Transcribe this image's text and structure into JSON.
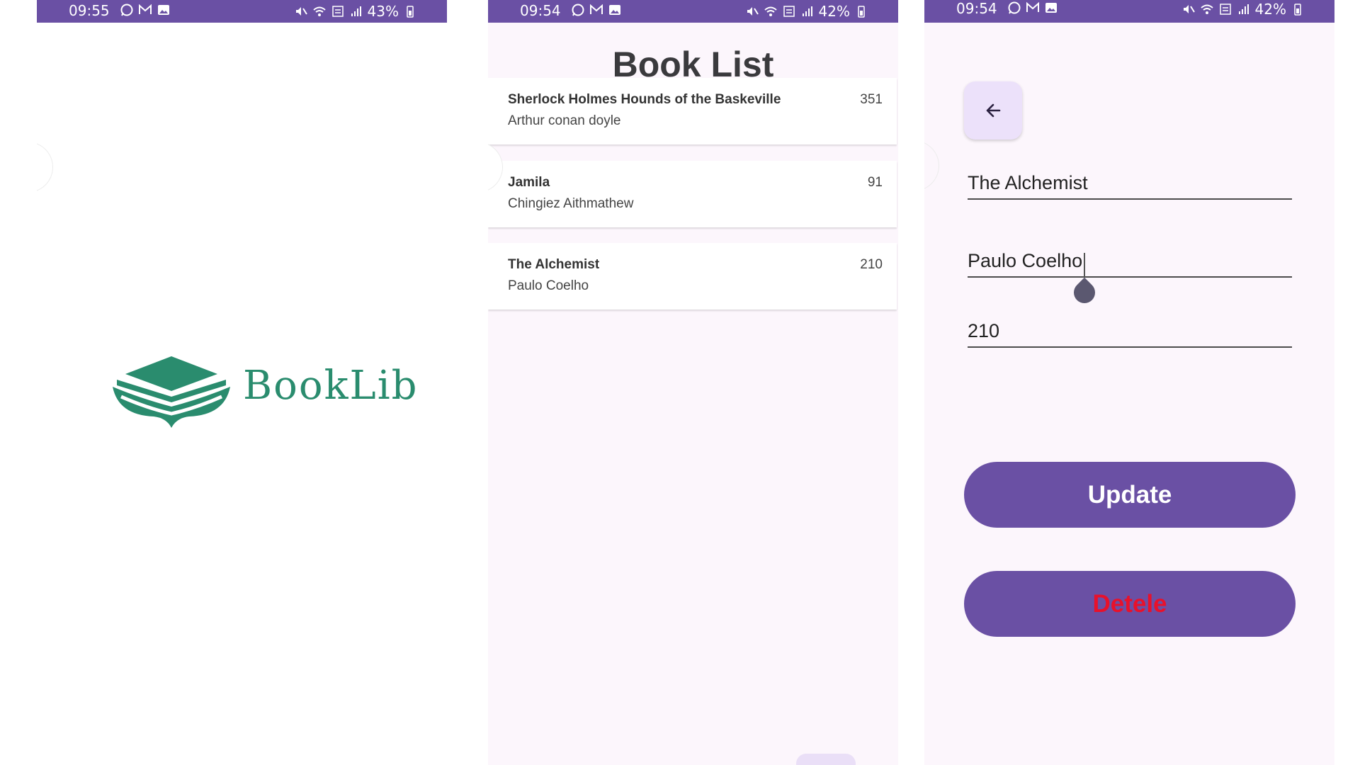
{
  "colors": {
    "status_bar": "#6a50a4",
    "accent": "#6a50a4",
    "brand_green": "#2a8c6e",
    "delete_text": "#e8112b",
    "screen_bg": "#fcf6fc"
  },
  "splash": {
    "status": {
      "time": "09:55",
      "battery": "43%"
    },
    "logo_text": "BookLib"
  },
  "list_screen": {
    "status": {
      "time": "09:54",
      "battery": "42%"
    },
    "title": "Book List",
    "books": [
      {
        "title": "Sherlock Holmes Hounds of the Baskeville",
        "author": "Arthur conan doyle",
        "pages": "351"
      },
      {
        "title": "Jamila",
        "author": "Chingiez Aithmathew",
        "pages": "91"
      },
      {
        "title": "The Alchemist",
        "author": "Paulo Coelho",
        "pages": "210"
      }
    ]
  },
  "edit_screen": {
    "status": {
      "time": "09:54",
      "battery": "42%"
    },
    "fields": {
      "title": "The Alchemist",
      "author": "Paulo Coelho",
      "pages": "210"
    },
    "update_label": "Update",
    "delete_label": "Detele"
  },
  "icons": {
    "status_left": [
      "whatsapp-icon",
      "gmail-icon",
      "gallery-icon"
    ],
    "status_right": [
      "mute-icon",
      "wifi-icon",
      "volte-icon",
      "signal-icon",
      "battery-icon"
    ],
    "back": "arrow-left-icon",
    "logo": "book-logo-icon"
  }
}
